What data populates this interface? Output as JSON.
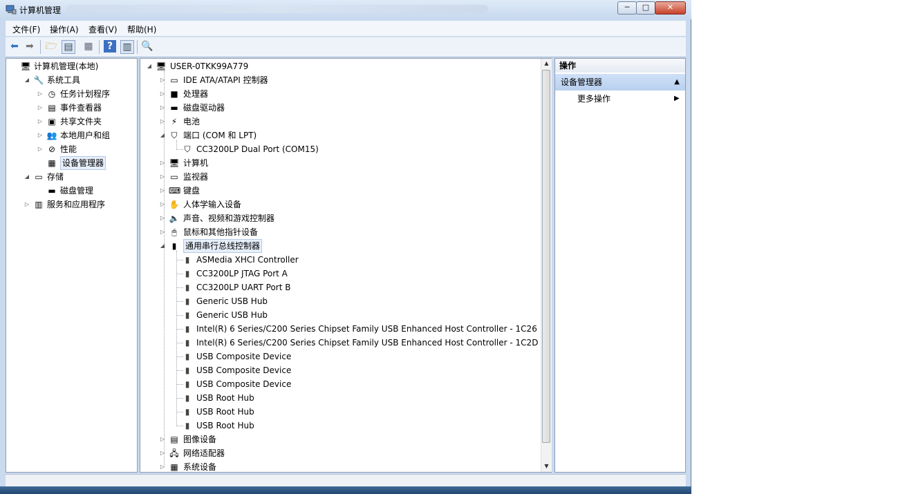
{
  "window": {
    "title": "计算机管理"
  },
  "menu": [
    "文件(F)",
    "操作(A)",
    "查看(V)",
    "帮助(H)"
  ],
  "left_tree": [
    {
      "label": "计算机管理(本地)",
      "level": 0,
      "expander": "",
      "icon": "computer-mgmt-icon"
    },
    {
      "label": "系统工具",
      "level": 1,
      "expander": "◢",
      "icon": "tools-icon"
    },
    {
      "label": "任务计划程序",
      "level": 2,
      "expander": "▷",
      "icon": "clock-icon"
    },
    {
      "label": "事件查看器",
      "level": 2,
      "expander": "▷",
      "icon": "event-viewer-icon"
    },
    {
      "label": "共享文件夹",
      "level": 2,
      "expander": "▷",
      "icon": "shared-folder-icon"
    },
    {
      "label": "本地用户和组",
      "level": 2,
      "expander": "▷",
      "icon": "users-icon"
    },
    {
      "label": "性能",
      "level": 2,
      "expander": "▷",
      "icon": "performance-icon"
    },
    {
      "label": "设备管理器",
      "level": 2,
      "expander": "",
      "icon": "device-manager-icon",
      "selected": true
    },
    {
      "label": "存储",
      "level": 1,
      "expander": "◢",
      "icon": "storage-icon"
    },
    {
      "label": "磁盘管理",
      "level": 2,
      "expander": "",
      "icon": "disk-mgmt-icon"
    },
    {
      "label": "服务和应用程序",
      "level": 1,
      "expander": "▷",
      "icon": "services-icon"
    }
  ],
  "device_tree": {
    "root": "USER-0TKK99A779",
    "items": [
      {
        "label": "IDE ATA/ATAPI 控制器",
        "expander": "▷",
        "icon": "ide-icon"
      },
      {
        "label": "处理器",
        "expander": "▷",
        "icon": "cpu-icon"
      },
      {
        "label": "磁盘驱动器",
        "expander": "▷",
        "icon": "disk-icon"
      },
      {
        "label": "电池",
        "expander": "▷",
        "icon": "battery-icon"
      },
      {
        "label": "端口 (COM 和 LPT)",
        "expander": "◢",
        "icon": "port-icon"
      },
      {
        "label": "CC3200LP Dual Port (COM15)",
        "child": true,
        "icon": "port-icon"
      },
      {
        "label": "计算机",
        "expander": "▷",
        "icon": "computer-icon"
      },
      {
        "label": "监视器",
        "expander": "▷",
        "icon": "monitor-icon"
      },
      {
        "label": "键盘",
        "expander": "▷",
        "icon": "keyboard-icon"
      },
      {
        "label": "人体学输入设备",
        "expander": "▷",
        "icon": "hid-icon"
      },
      {
        "label": "声音、视频和游戏控制器",
        "expander": "▷",
        "icon": "sound-icon"
      },
      {
        "label": "鼠标和其他指针设备",
        "expander": "▷",
        "icon": "mouse-icon"
      },
      {
        "label": "通用串行总线控制器",
        "expander": "◢",
        "icon": "usb-icon",
        "selected": true
      },
      {
        "label": "ASMedia XHCI Controller",
        "child": true,
        "icon": "usb-icon"
      },
      {
        "label": "CC3200LP JTAG Port A",
        "child": true,
        "icon": "usb-icon"
      },
      {
        "label": "CC3200LP UART Port B",
        "child": true,
        "icon": "usb-icon"
      },
      {
        "label": "Generic USB Hub",
        "child": true,
        "icon": "usb-icon"
      },
      {
        "label": "Generic USB Hub",
        "child": true,
        "icon": "usb-icon"
      },
      {
        "label": "Intel(R) 6 Series/C200 Series Chipset Family USB Enhanced Host Controller - 1C26",
        "child": true,
        "icon": "usb-icon"
      },
      {
        "label": "Intel(R) 6 Series/C200 Series Chipset Family USB Enhanced Host Controller - 1C2D",
        "child": true,
        "icon": "usb-icon"
      },
      {
        "label": "USB Composite Device",
        "child": true,
        "icon": "usb-icon"
      },
      {
        "label": "USB Composite Device",
        "child": true,
        "icon": "usb-icon"
      },
      {
        "label": "USB Composite Device",
        "child": true,
        "icon": "usb-icon"
      },
      {
        "label": "USB Root Hub",
        "child": true,
        "icon": "usb-icon"
      },
      {
        "label": "USB Root Hub",
        "child": true,
        "icon": "usb-icon"
      },
      {
        "label": "USB Root Hub",
        "child": true,
        "icon": "usb-icon"
      },
      {
        "label": "图像设备",
        "expander": "▷",
        "icon": "camera-icon"
      },
      {
        "label": "网络适配器",
        "expander": "▷",
        "icon": "network-icon"
      },
      {
        "label": "系统设备",
        "expander": "▷",
        "icon": "system-icon"
      }
    ]
  },
  "actions": {
    "header": "操作",
    "section": "设备管理器",
    "more": "更多操作"
  }
}
